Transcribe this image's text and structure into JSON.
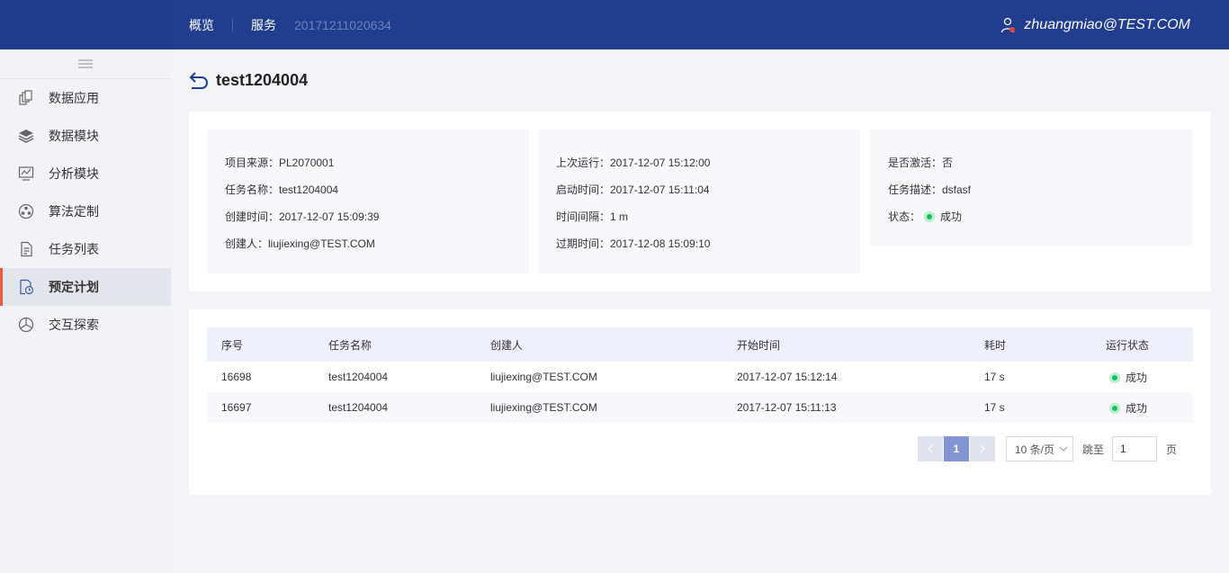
{
  "header": {
    "nav": [
      "概览",
      "服务"
    ],
    "breadcrumb": "20171211020634",
    "user": "zhuangmiao@TEST.COM"
  },
  "sidebar": {
    "items": [
      {
        "label": "数据应用",
        "icon": "data-app-icon"
      },
      {
        "label": "数据模块",
        "icon": "layers-icon"
      },
      {
        "label": "分析模块",
        "icon": "analysis-icon"
      },
      {
        "label": "算法定制",
        "icon": "algorithm-icon"
      },
      {
        "label": "任务列表",
        "icon": "task-list-icon"
      },
      {
        "label": "预定计划",
        "icon": "schedule-icon",
        "active": true
      },
      {
        "label": "交互探索",
        "icon": "explore-icon"
      }
    ]
  },
  "page": {
    "title": "test1204004"
  },
  "info": {
    "col1": [
      "项目来源：PL2070001",
      "任务名称：test1204004",
      "创建时间：2017-12-07   15:09:39",
      "创建人：liujiexing@TEST.COM"
    ],
    "col2": [
      "上次运行：2017-12-07   15:12:00",
      "启动时间：2017-12-07   15:11:04",
      "时间间隔：1 m",
      "过期时间：2017-12-08   15:09:10"
    ],
    "col3": [
      "是否激活：否",
      "任务描述：dsfasf"
    ],
    "status_label": "状态：",
    "status_value": "成功"
  },
  "table": {
    "headers": [
      "序号",
      "任务名称",
      "创建人",
      "开始时间",
      "耗时",
      "运行状态"
    ],
    "rows": [
      [
        "16698",
        "test1204004",
        "liujiexing@TEST.COM",
        "2017-12-07   15:12:14",
        "17 s",
        "成功"
      ],
      [
        "16697",
        "test1204004",
        "liujiexing@TEST.COM",
        "2017-12-07   15:11:13",
        "17 s",
        "成功"
      ]
    ]
  },
  "pagination": {
    "current": "1",
    "page_size": "10 条/页",
    "jump_label": "跳至",
    "jump_value": "1",
    "page_suffix": "页"
  },
  "colors": {
    "header_bg": "#203d8e",
    "active_indicator": "#f05a3a",
    "success": "#17bf63",
    "pager_active": "#8195d3"
  }
}
